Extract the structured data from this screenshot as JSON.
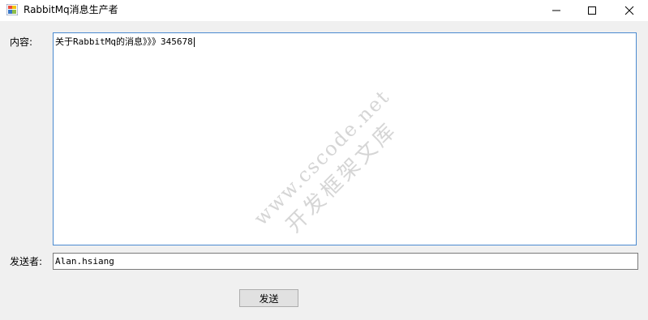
{
  "window": {
    "title": "RabbitMq消息生产者",
    "controls": {
      "minimize": "minimize",
      "maximize": "maximize",
      "close": "close"
    }
  },
  "form": {
    "content_label": "内容:",
    "content_value": "关于RabbitMq的消息》》》345678",
    "sender_label": "发送者:",
    "sender_value": "Alan.hsiang",
    "send_button": "发送"
  },
  "watermark": {
    "line1": "www.cscode.net",
    "line2": "开发框架文库"
  }
}
